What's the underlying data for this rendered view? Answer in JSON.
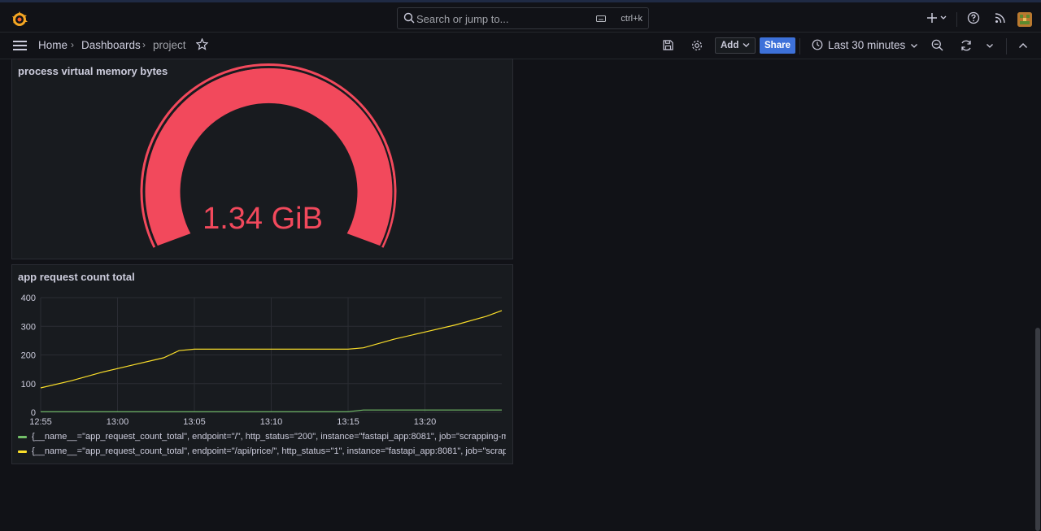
{
  "topbar": {
    "search_placeholder": "Search or jump to...",
    "search_shortcut": "ctrl+k"
  },
  "navbar": {
    "breadcrumbs": [
      "Home",
      "Dashboards",
      "project"
    ],
    "add_label": "Add",
    "share_label": "Share",
    "time_range": "Last 30 minutes"
  },
  "gauge_panel": {
    "title": "process virtual memory bytes",
    "value_text": "1.34 GiB",
    "color": "#f2495c"
  },
  "chart_panel": {
    "title": "app request count total",
    "legend": [
      {
        "label": "{__name__=\"app_request_count_total\", endpoint=\"/\", http_status=\"200\", instance=\"fastapi_app:8081\", job=\"scrapping-m",
        "color": "#73bf69"
      },
      {
        "label": "{__name__=\"app_request_count_total\", endpoint=\"/api/price/\", http_status=\"1\", instance=\"fastapi_app:8081\", job=\"scrapp",
        "color": "#fade2a"
      }
    ]
  },
  "chart_data": {
    "type": "line",
    "x_ticks": [
      "12:55",
      "13:00",
      "13:05",
      "13:10",
      "13:15",
      "13:20"
    ],
    "y_ticks": [
      "0",
      "100",
      "200",
      "300",
      "400"
    ],
    "ylim": [
      0,
      400
    ],
    "xlim": [
      "12:55",
      "13:25"
    ],
    "grid": true,
    "legend_position": "bottom",
    "series": [
      {
        "color": "#73bf69",
        "x": [
          "12:55",
          "13:00",
          "13:05",
          "13:10",
          "13:15",
          "13:16",
          "13:20",
          "13:25"
        ],
        "y": [
          2,
          2,
          2,
          2,
          2,
          8,
          8,
          8
        ]
      },
      {
        "color": "#fade2a",
        "x": [
          "12:55",
          "12:57",
          "12:59",
          "13:01",
          "13:03",
          "13:04",
          "13:05",
          "13:10",
          "13:15",
          "13:16",
          "13:18",
          "13:20",
          "13:22",
          "13:24",
          "13:25"
        ],
        "y": [
          85,
          110,
          140,
          165,
          190,
          215,
          220,
          220,
          220,
          225,
          255,
          280,
          305,
          335,
          355
        ]
      }
    ]
  }
}
